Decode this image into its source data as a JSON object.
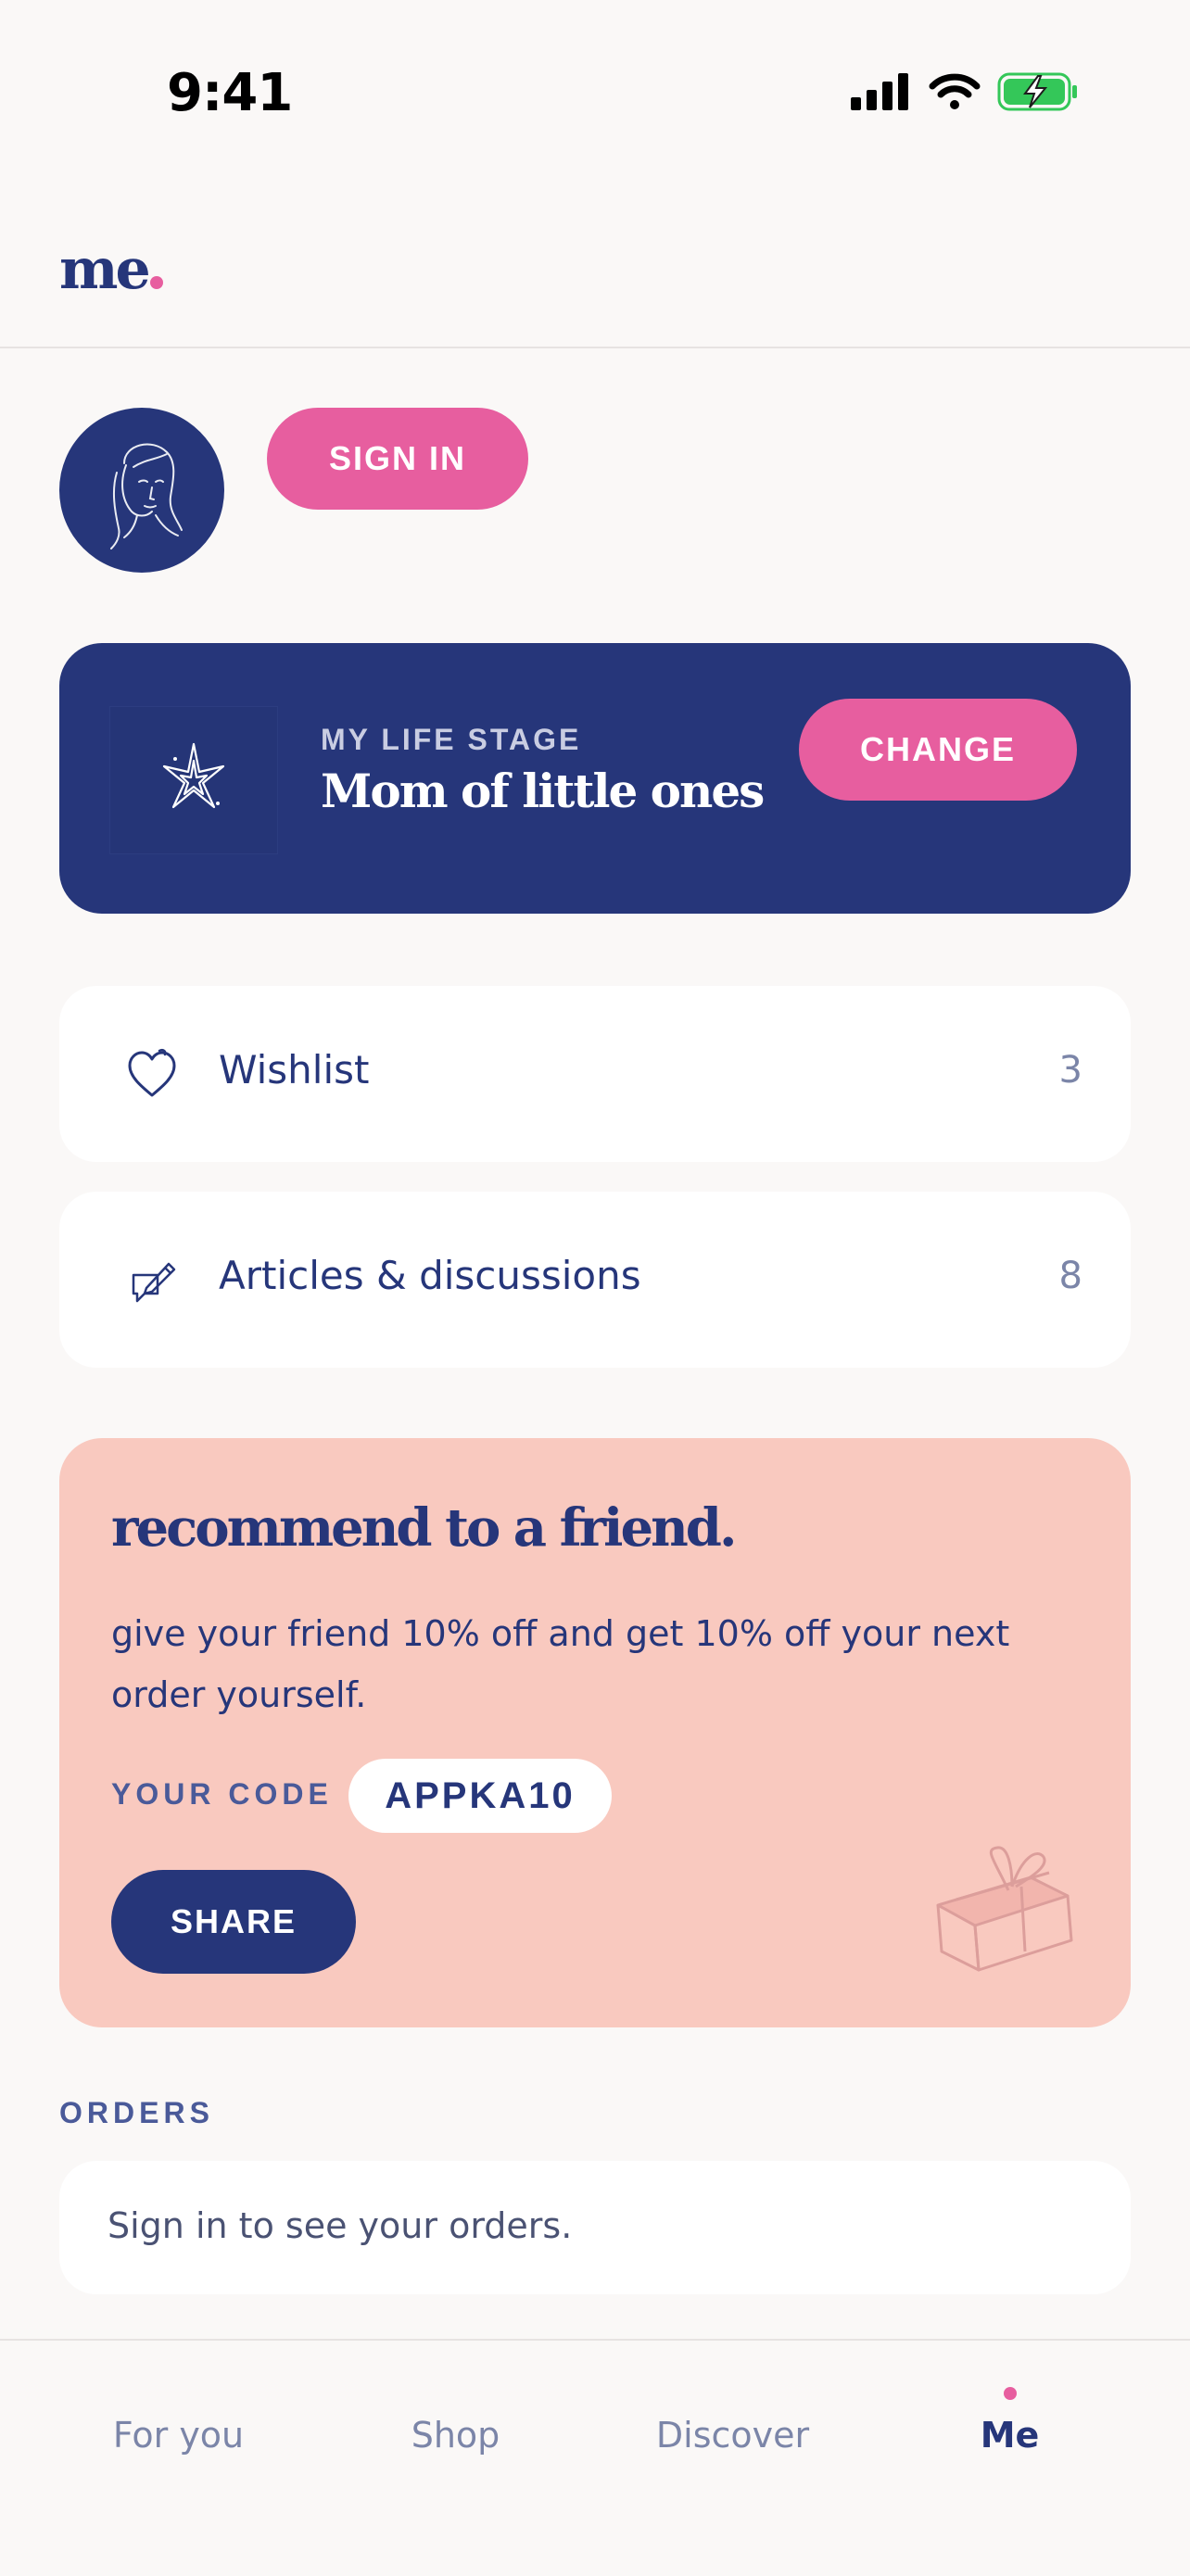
{
  "status_bar": {
    "time": "9:41"
  },
  "header": {
    "logo": "me"
  },
  "profile": {
    "sign_in_label": "SIGN IN"
  },
  "life_stage": {
    "label": "MY LIFE STAGE",
    "value": "Mom of little ones",
    "change_label": "CHANGE"
  },
  "menu": {
    "items": [
      {
        "label": "Wishlist",
        "count": "3",
        "icon": "heart-icon"
      },
      {
        "label": "Articles & discussions",
        "count": "8",
        "icon": "pen-message-icon"
      }
    ]
  },
  "recommend": {
    "title": "recommend to a friend.",
    "body": "give your friend 10% off and get 10% off your next order yourself.",
    "code_label": "YOUR CODE",
    "code": "APPKA10",
    "share_label": "SHARE"
  },
  "orders": {
    "heading": "ORDERS",
    "empty_text": "Sign in to see your orders."
  },
  "tabs": [
    {
      "label": "For you",
      "active": false
    },
    {
      "label": "Shop",
      "active": false
    },
    {
      "label": "Discover",
      "active": false
    },
    {
      "label": "Me",
      "active": true
    }
  ],
  "colors": {
    "brand_navy": "#26367a",
    "brand_pink": "#e75e9f",
    "peach": "#f9c9bf",
    "background": "#faf8f7"
  }
}
